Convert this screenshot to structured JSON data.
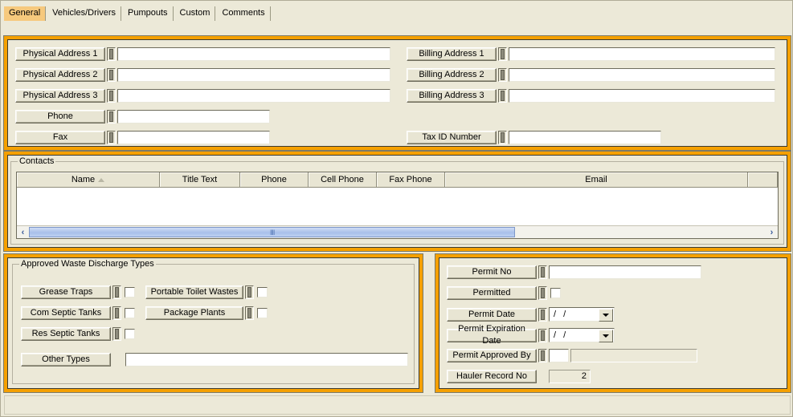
{
  "tabs": [
    {
      "label": "General",
      "active": true
    },
    {
      "label": "Vehicles/Drivers",
      "active": false
    },
    {
      "label": "Pumpouts",
      "active": false
    },
    {
      "label": "Custom",
      "active": false
    },
    {
      "label": "Comments",
      "active": false
    }
  ],
  "address_panel": {
    "left_fields": [
      {
        "label": "Physical Address 1",
        "value": ""
      },
      {
        "label": "Physical Address 2",
        "value": ""
      },
      {
        "label": "Physical Address 3",
        "value": ""
      },
      {
        "label": "Phone",
        "value": ""
      },
      {
        "label": "Fax",
        "value": ""
      }
    ],
    "right_fields": [
      {
        "label": "Billing Address 1",
        "value": ""
      },
      {
        "label": "Billing Address 2",
        "value": ""
      },
      {
        "label": "Billing Address 3",
        "value": ""
      },
      {
        "label": "Tax ID Number",
        "value": ""
      }
    ]
  },
  "contacts": {
    "caption": "Contacts",
    "columns": [
      "Name",
      "Title Text",
      "Phone",
      "Cell Phone",
      "Fax Phone",
      "Email"
    ],
    "sort_column": "Name",
    "sort_direction": "ascending",
    "rows": [],
    "scrollbar": {
      "left_arrow": "‹",
      "right_arrow": "›",
      "grip": "‖‖"
    }
  },
  "waste_panel": {
    "caption": "Approved Waste Discharge Types",
    "checkboxes": [
      {
        "label": "Grease Traps",
        "checked": false
      },
      {
        "label": "Com Septic Tanks",
        "checked": false
      },
      {
        "label": "Res Septic Tanks",
        "checked": false
      },
      {
        "label": "Portable Toilet Wastes",
        "checked": false
      },
      {
        "label": "Package Plants",
        "checked": false
      }
    ],
    "other_types": {
      "label": "Other Types",
      "value": ""
    }
  },
  "permit_panel": {
    "permit_no": {
      "label": "Permit No",
      "value": ""
    },
    "permitted": {
      "label": "Permitted",
      "checked": false
    },
    "permit_date": {
      "label": "Permit Date",
      "value": "/ /"
    },
    "permit_expiration_date": {
      "label": "Permit Expiration Date",
      "value": "/ /"
    },
    "permit_approved_by": {
      "label": "Permit Approved By",
      "code": "",
      "name": ""
    },
    "hauler_record_no": {
      "label": "Hauler Record No",
      "value": "2"
    }
  },
  "colors": {
    "panel_border": "#f5a000",
    "active_tab": "#f6c97d",
    "face": "#ece9d8",
    "scrollbar_thumb": "#a8c0ea"
  }
}
